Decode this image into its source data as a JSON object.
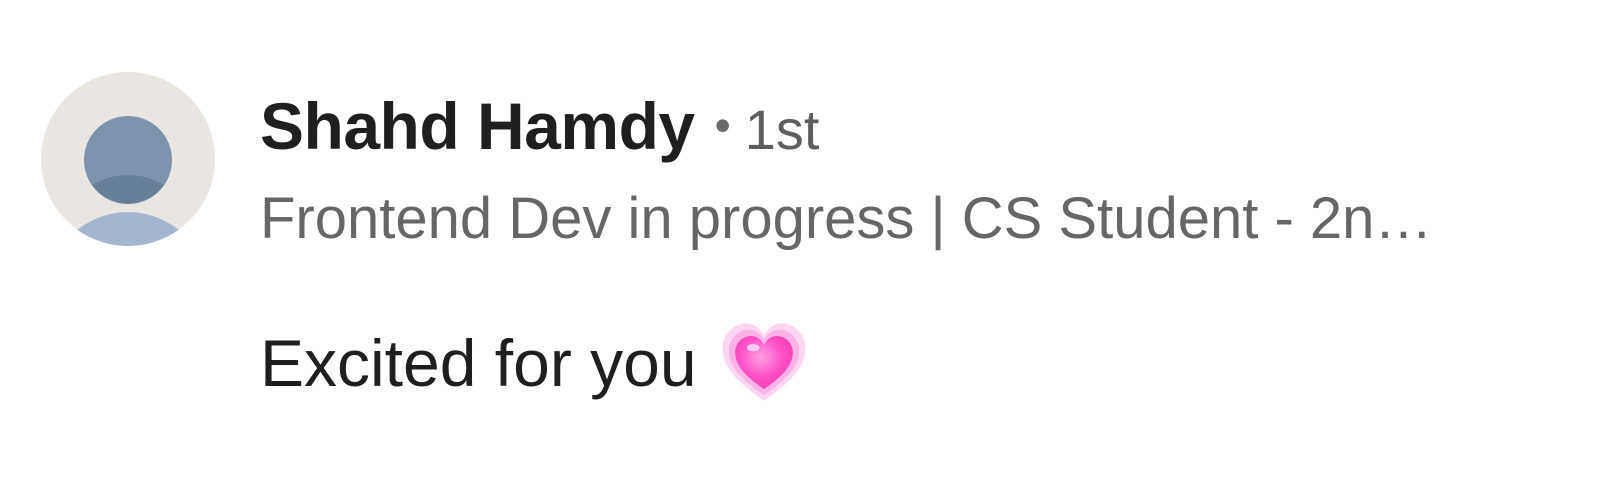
{
  "comment": {
    "author": {
      "name": "Shahd Hamdy",
      "separator": "•",
      "connection": "1st",
      "headline": "Frontend Dev in progress | CS Student - 2n…",
      "avatar_icon": "default-person-avatar"
    },
    "text": "Excited for you",
    "emoji": {
      "name": "growing-heart-icon",
      "color": "#ff5fc8"
    }
  },
  "colors": {
    "avatar_bg": "#e9e5e0",
    "avatar_figure": "#7d93ab",
    "avatar_body": "#a3b6cd",
    "name_text": "#1f1f1f",
    "secondary_text": "#666666"
  }
}
